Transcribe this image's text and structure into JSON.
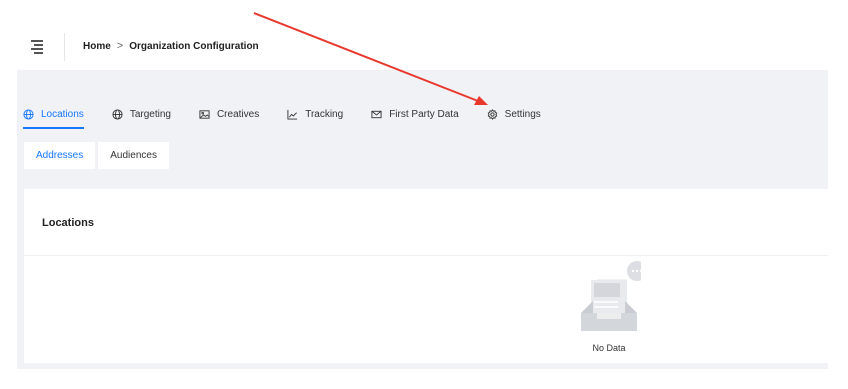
{
  "header": {
    "breadcrumb": {
      "home": "Home",
      "separator": ">",
      "current": "Organization Configuration"
    }
  },
  "tabs": [
    {
      "label": "Locations",
      "icon": "globe-icon",
      "active": true
    },
    {
      "label": "Targeting",
      "icon": "target-globe-icon",
      "active": false
    },
    {
      "label": "Creatives",
      "icon": "image-icon",
      "active": false
    },
    {
      "label": "Tracking",
      "icon": "line-chart-icon",
      "active": false
    },
    {
      "label": "First Party Data",
      "icon": "mail-icon",
      "active": false
    },
    {
      "label": "Settings",
      "icon": "gear-icon",
      "active": false
    }
  ],
  "subtabs": [
    {
      "label": "Addresses",
      "active": true
    },
    {
      "label": "Audiences",
      "active": false
    }
  ],
  "card": {
    "title": "Locations",
    "empty_text": "No Data"
  },
  "colors": {
    "accent": "#1677ff",
    "background": "#f0f2f5",
    "annotation_arrow": "#e8372d"
  }
}
